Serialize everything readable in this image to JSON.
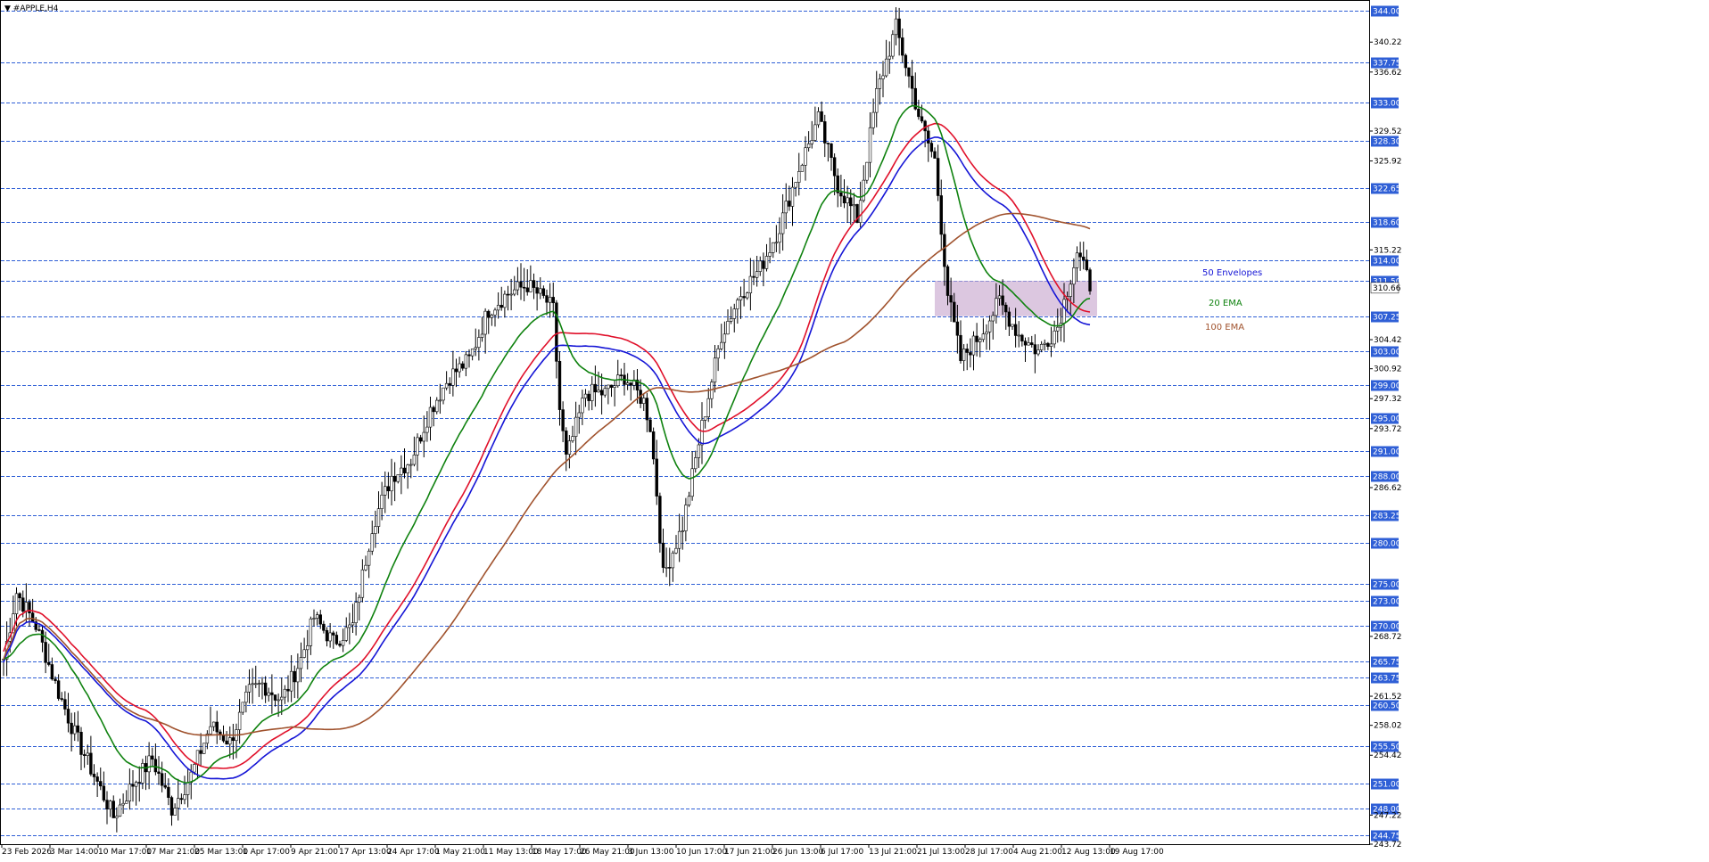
{
  "chart_data": {
    "type": "candlestick",
    "title": "▼ #APPLE,H4",
    "ylim": [
      243.72,
      344.0
    ],
    "y_ticks": [
      340.22,
      336.62,
      329.52,
      325.92,
      315.22,
      304.42,
      300.92,
      297.32,
      293.72,
      286.62,
      268.72,
      261.52,
      258.02,
      254.42,
      247.22,
      243.72
    ],
    "sr_levels": [
      344.0,
      337.75,
      333.0,
      328.3,
      322.65,
      318.6,
      314.0,
      311.5,
      307.25,
      303.0,
      299.0,
      295.0,
      291.0,
      288.0,
      283.25,
      280.0,
      275.0,
      273.0,
      270.0,
      265.75,
      263.75,
      260.5,
      255.5,
      251.0,
      248.0,
      244.75
    ],
    "sr_labels": [
      "344.00",
      "337.75",
      "333.00",
      "328.30",
      "322.65",
      "318.60",
      "314.00",
      "311.50",
      "307.25",
      "303.00",
      "299.00",
      "295.00",
      "291.00",
      "288.00",
      "283.25",
      "280.00",
      "275.00",
      "273.00",
      "270.00",
      "265.75",
      "263.75",
      "260.50",
      "255.50",
      "251.00",
      "248.00",
      "244.75"
    ],
    "current_price": 310.66,
    "current_price_label": "310.66",
    "x_labels": [
      "23 Feb 2026",
      "3 Mar 14:00",
      "10 Mar 17:00",
      "17 Mar 21:00",
      "25 Mar 13:00",
      "1 Apr 17:00",
      "9 Apr 21:00",
      "17 Apr 13:00",
      "24 Apr 17:00",
      "1 May 21:00",
      "11 May 13:00",
      "18 May 17:00",
      "26 May 21:00",
      "3 Jun 13:00",
      "10 Jun 17:00",
      "17 Jun 21:00",
      "26 Jun 13:00",
      "6 Jul 17:00",
      "13 Jul 21:00",
      "21 Jul 13:00",
      "28 Jul 17:00",
      "4 Aug 21:00",
      "12 Aug 13:00",
      "19 Aug 17:00"
    ],
    "price_path": [
      [
        0,
        266
      ],
      [
        2,
        274
      ],
      [
        5,
        270
      ],
      [
        8,
        263
      ],
      [
        11,
        257
      ],
      [
        14,
        252
      ],
      [
        17,
        247
      ],
      [
        20,
        251
      ],
      [
        23,
        254
      ],
      [
        26,
        248
      ],
      [
        29,
        252
      ],
      [
        32,
        258
      ],
      [
        35,
        256
      ],
      [
        38,
        262
      ],
      [
        40,
        263
      ],
      [
        43,
        261
      ],
      [
        46,
        266
      ],
      [
        48,
        271
      ],
      [
        51,
        268
      ],
      [
        54,
        270
      ],
      [
        57,
        282
      ],
      [
        60,
        288
      ],
      [
        63,
        290
      ],
      [
        66,
        296
      ],
      [
        69,
        300
      ],
      [
        72,
        302
      ],
      [
        75,
        308
      ],
      [
        78,
        310
      ],
      [
        81,
        311
      ],
      [
        84,
        309
      ],
      [
        85,
        308
      ],
      [
        86,
        296
      ],
      [
        87,
        290
      ],
      [
        90,
        298
      ],
      [
        93,
        298
      ],
      [
        96,
        300
      ],
      [
        99,
        297
      ],
      [
        100,
        294
      ],
      [
        101,
        286
      ],
      [
        102,
        276
      ],
      [
        105,
        282
      ],
      [
        108,
        294
      ],
      [
        111,
        305
      ],
      [
        114,
        310
      ],
      [
        117,
        313
      ],
      [
        120,
        318
      ],
      [
        123,
        325
      ],
      [
        126,
        331
      ],
      [
        129,
        323
      ],
      [
        132,
        319
      ],
      [
        135,
        334
      ],
      [
        138,
        342
      ],
      [
        140,
        336
      ],
      [
        142,
        330
      ],
      [
        144,
        326
      ],
      [
        146,
        310
      ],
      [
        148,
        302
      ],
      [
        151,
        305
      ],
      [
        154,
        309
      ],
      [
        157,
        305
      ],
      [
        160,
        303
      ],
      [
        163,
        306
      ],
      [
        166,
        315
      ],
      [
        168,
        311
      ]
    ],
    "series": [
      {
        "name": "50 Envelopes",
        "color": "#e0102a",
        "shade": "#a78ab6"
      },
      {
        "name": "20 EMA",
        "color": "#0f820f",
        "shade": ""
      },
      {
        "name": "100 EMA",
        "color": "#a0522d",
        "shade": ""
      }
    ],
    "zone": {
      "price_top": 311.5,
      "price_bottom": 307.25,
      "color": "#c9a9d0"
    }
  }
}
